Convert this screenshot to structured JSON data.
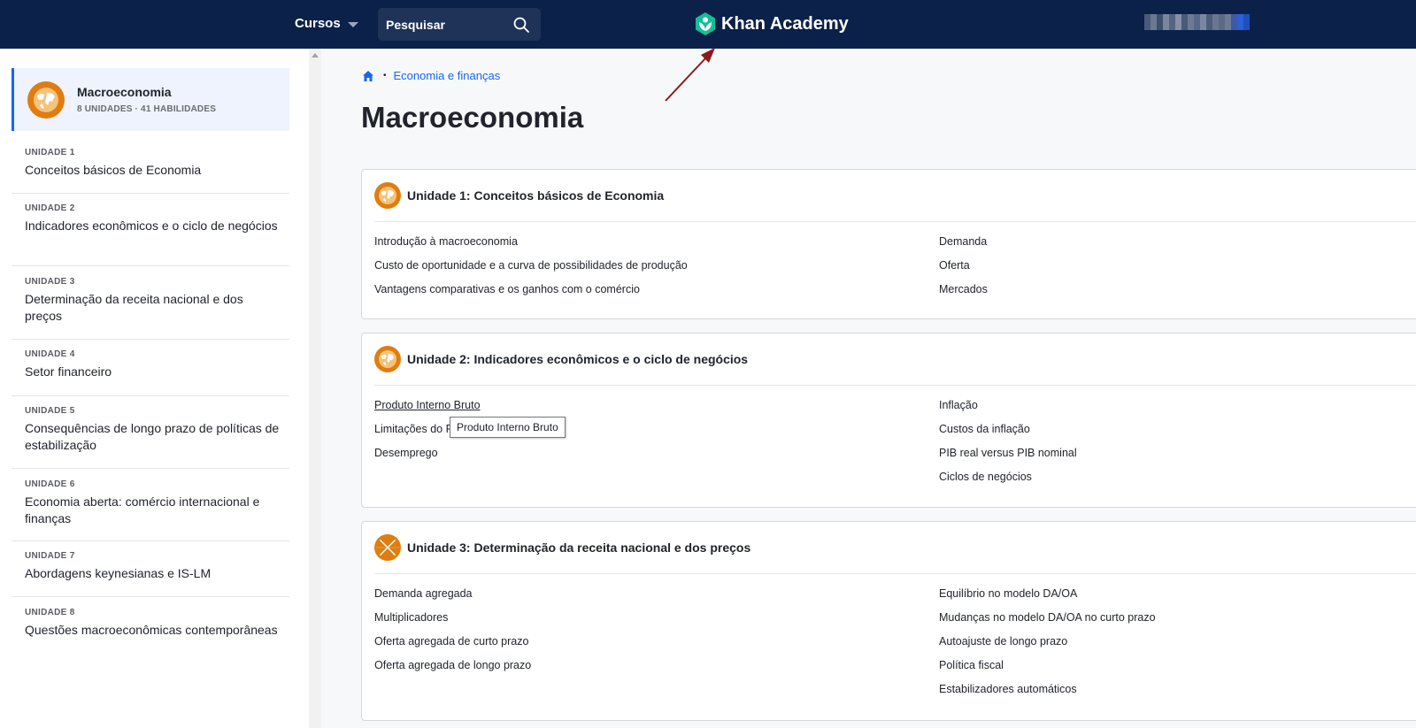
{
  "topbar": {
    "courses_label": "Cursos",
    "search_placeholder": "Pesquisar",
    "logo_text": "Khan Academy",
    "colors": {
      "background": "#0b2149",
      "logo_green": "#14bf96"
    }
  },
  "sidebar": {
    "course": {
      "title": "Macroeconomia",
      "subtitle": "8 UNIDADES · 41 HABILIDADES"
    },
    "units": [
      {
        "label": "UNIDADE 1",
        "name": "Conceitos básicos de Economia"
      },
      {
        "label": "UNIDADE 2",
        "name": "Indicadores econômicos e o ciclo de negócios"
      },
      {
        "label": "UNIDADE 3",
        "name": "Determinação da receita nacional e dos preços"
      },
      {
        "label": "UNIDADE 4",
        "name": "Setor financeiro"
      },
      {
        "label": "UNIDADE 5",
        "name": "Consequências de longo prazo de políticas de estabilização"
      },
      {
        "label": "UNIDADE 6",
        "name": "Economia aberta: comércio internacional e finanças"
      },
      {
        "label": "UNIDADE 7",
        "name": "Abordagens keynesianas e IS-LM"
      },
      {
        "label": "UNIDADE 8",
        "name": "Questões macroeconômicas contemporâneas"
      }
    ]
  },
  "breadcrumb": {
    "link": "Economia e finanças",
    "separator": "•"
  },
  "page_title": "Macroeconomia",
  "unit_cards": [
    {
      "title": "Unidade 1: Conceitos básicos de Economia",
      "left": [
        "Introdução à macroeconomia",
        "Custo de oportunidade e a curva de possibilidades de produção",
        "Vantagens comparativas e os ganhos com o comércio"
      ],
      "right": [
        "Demanda",
        "Oferta",
        "Mercados"
      ]
    },
    {
      "title": "Unidade 2: Indicadores econômicos e o ciclo de negócios",
      "left": [
        "Produto Interno Bruto",
        "Limitações do PIB",
        "Desemprego"
      ],
      "right": [
        "Inflação",
        "Custos da inflação",
        "PIB real versus PIB nominal",
        "Ciclos de negócios"
      ]
    },
    {
      "title": "Unidade 3: Determinação da receita nacional e dos preços",
      "left": [
        "Demanda agregada",
        "Multiplicadores",
        "Oferta agregada de curto prazo",
        "Oferta agregada de longo prazo"
      ],
      "right": [
        "Equilíbrio no modelo DA/OA",
        "Mudanças no modelo DA/OA no curto prazo",
        "Autoajuste de longo prazo",
        "Política fiscal",
        "Estabilizadores automáticos"
      ]
    }
  ],
  "tooltip": "Produto Interno Bruto",
  "accent_colors": {
    "link_blue": "#1865f2",
    "unit_orange": "#e07d10",
    "annotation_arrow": "#8b1a1a"
  }
}
